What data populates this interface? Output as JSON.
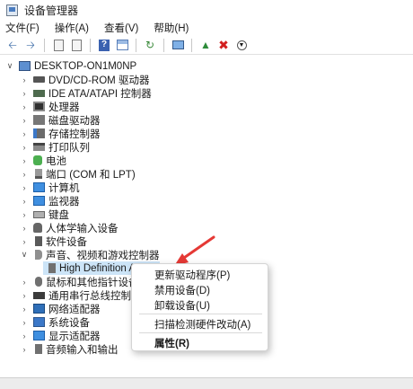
{
  "window": {
    "title": "设备管理器",
    "icon": "device-manager-icon"
  },
  "menu": {
    "file": "文件(F)",
    "action": "操作(A)",
    "view": "查看(V)",
    "help": "帮助(H)"
  },
  "toolbar": {
    "back_icon": "arrow-left-icon",
    "forward_icon": "arrow-right-icon",
    "props_icon": "properties-icon",
    "help_icon": "help-icon",
    "scan_icon": "scan-icon",
    "monitor_icon": "monitor-icon",
    "enable_icon": "enable-device-icon",
    "uninstall_icon": "uninstall-icon",
    "update_icon": "update-driver-icon"
  },
  "tree": {
    "root": "DESKTOP-ON1M0NP",
    "categories": [
      "DVD/CD-ROM 驱动器",
      "IDE ATA/ATAPI 控制器",
      "处理器",
      "磁盘驱动器",
      "存储控制器",
      "打印队列",
      "电池",
      "端口 (COM 和 LPT)",
      "计算机",
      "监视器",
      "键盘",
      "人体学输入设备",
      "软件设备",
      "声音、视频和游戏控制器",
      "鼠标和其他指针设备",
      "通用串行总线控制器",
      "网络适配器",
      "系统设备",
      "显示适配器",
      "音频输入和输出"
    ],
    "selected_device": "High Definition Au"
  },
  "context_menu": {
    "update_driver": "更新驱动程序(P)",
    "disable_device": "禁用设备(D)",
    "uninstall_device": "卸载设备(U)",
    "scan_hardware": "扫描检测硬件改动(A)",
    "properties": "属性(R)"
  },
  "colors": {
    "arrow": "#e53935",
    "accent": "#3c78c8"
  }
}
